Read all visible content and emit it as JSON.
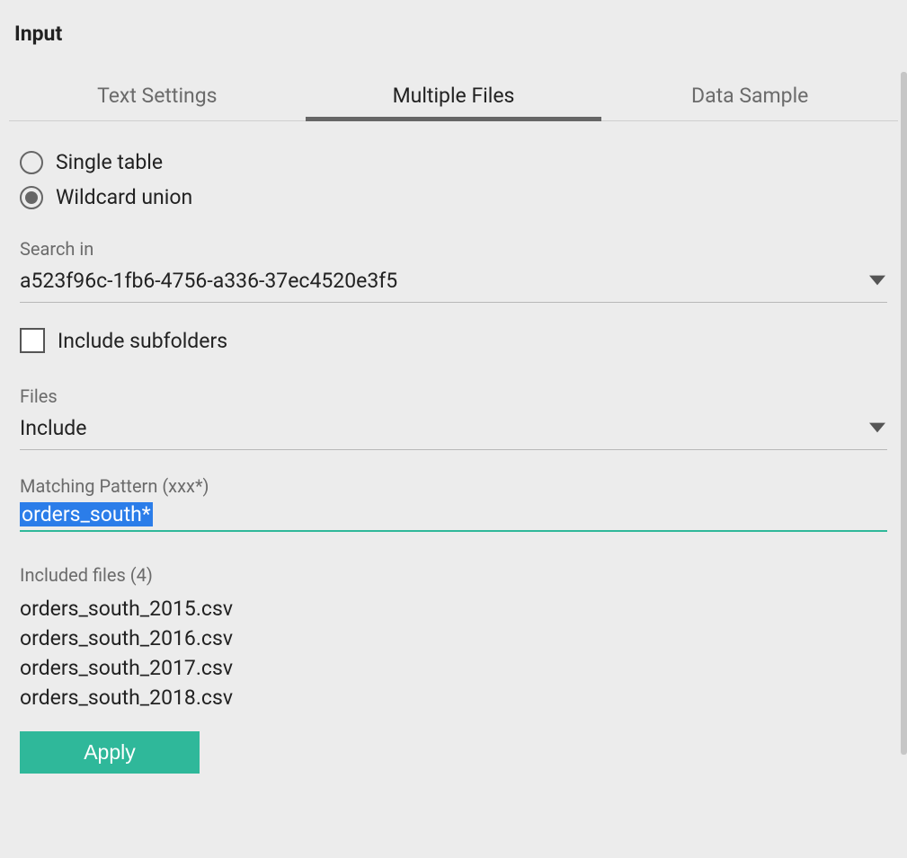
{
  "panel_title": "Input",
  "tabs": [
    {
      "label": "Text Settings",
      "active": false
    },
    {
      "label": "Multiple Files",
      "active": true
    },
    {
      "label": "Data Sample",
      "active": false
    }
  ],
  "radios": {
    "single_table_label": "Single table",
    "wildcard_union_label": "Wildcard union",
    "selected": "wildcard_union"
  },
  "search_in": {
    "label": "Search in",
    "value": "a523f96c-1fb6-4756-a336-37ec4520e3f5"
  },
  "include_subfolders": {
    "label": "Include subfolders",
    "checked": false
  },
  "files_filter": {
    "label": "Files",
    "value": "Include"
  },
  "matching_pattern": {
    "label": "Matching Pattern (xxx*)",
    "value": "orders_south*"
  },
  "included_files": {
    "label": "Included files (4)",
    "items": [
      "orders_south_2015.csv",
      "orders_south_2016.csv",
      "orders_south_2017.csv",
      "orders_south_2018.csv"
    ]
  },
  "apply_label": "Apply"
}
